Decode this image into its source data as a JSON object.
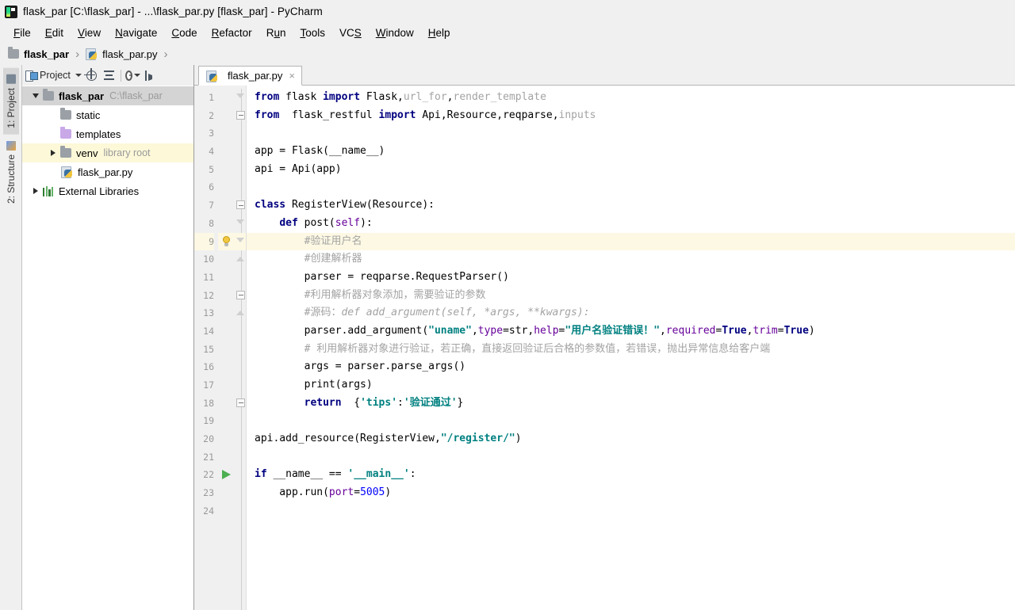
{
  "window": {
    "title": "flask_par [C:\\flask_par] - ...\\flask_par.py [flask_par] - PyCharm",
    "app_icon": "pycharm-icon"
  },
  "menubar": {
    "items": [
      {
        "label": "File",
        "mnemonic": "F"
      },
      {
        "label": "Edit",
        "mnemonic": "E"
      },
      {
        "label": "View",
        "mnemonic": "V"
      },
      {
        "label": "Navigate",
        "mnemonic": "N"
      },
      {
        "label": "Code",
        "mnemonic": "C"
      },
      {
        "label": "Refactor",
        "mnemonic": "R"
      },
      {
        "label": "Run",
        "mnemonic": "u"
      },
      {
        "label": "Tools",
        "mnemonic": "T"
      },
      {
        "label": "VCS",
        "mnemonic": "S"
      },
      {
        "label": "Window",
        "mnemonic": "W"
      },
      {
        "label": "Help",
        "mnemonic": "H"
      }
    ]
  },
  "breadcrumb": {
    "items": [
      {
        "label": "flask_par",
        "icon": "folder-icon",
        "bold": true
      },
      {
        "label": "flask_par.py",
        "icon": "python-file-icon",
        "bold": false
      }
    ],
    "separator": "›"
  },
  "left_toolwindows": [
    {
      "label": "1: Project",
      "icon": "project-window-icon",
      "active": true
    },
    {
      "label": "2: Structure",
      "icon": "structure-window-icon",
      "active": false
    }
  ],
  "project_panel": {
    "toolbar": {
      "title": "Project",
      "buttons": [
        {
          "name": "locate-file-icon",
          "tooltip": "Select Opened File"
        },
        {
          "name": "collapse-all-icon",
          "tooltip": "Collapse All"
        },
        {
          "name": "gear-icon",
          "tooltip": "Settings"
        },
        {
          "name": "hide-icon",
          "tooltip": "Hide"
        }
      ]
    },
    "tree": [
      {
        "label": "flask_par",
        "sub": "C:\\flask_par",
        "icon": "folder-icon",
        "indent": 0,
        "expander": "down",
        "selected": true,
        "bold": true
      },
      {
        "label": "static",
        "sub": "",
        "icon": "folder-icon",
        "indent": 1,
        "expander": "none",
        "selected": false,
        "bold": false
      },
      {
        "label": "templates",
        "sub": "",
        "icon": "folder-purple-icon",
        "indent": 1,
        "expander": "none",
        "selected": false,
        "bold": false
      },
      {
        "label": "venv",
        "sub": "library root",
        "icon": "folder-icon",
        "indent": 1,
        "expander": "right",
        "selected": false,
        "bold": false,
        "highlight": true
      },
      {
        "label": "flask_par.py",
        "sub": "",
        "icon": "python-file-icon",
        "indent": 1,
        "expander": "none",
        "selected": false,
        "bold": false
      },
      {
        "label": "External Libraries",
        "sub": "",
        "icon": "library-icon",
        "indent": 0,
        "expander": "right",
        "selected": false,
        "bold": false
      }
    ]
  },
  "editor": {
    "tabs": [
      {
        "label": "flask_par.py",
        "icon": "python-file-icon",
        "active": true,
        "close": "×"
      }
    ],
    "current_line": 9,
    "total_lines": 24,
    "gutter_marks": [
      {
        "line": 9,
        "icon": "lightbulb-icon"
      },
      {
        "line": 22,
        "icon": "run-arrow-icon"
      }
    ],
    "lines": [
      {
        "n": 1,
        "tokens": [
          {
            "t": "from",
            "c": "kw"
          },
          {
            "t": " flask ",
            "c": "plain"
          },
          {
            "t": "import",
            "c": "kw"
          },
          {
            "t": " Flask,",
            "c": "plain"
          },
          {
            "t": "url_for",
            "c": "dim"
          },
          {
            "t": ",",
            "c": "plain"
          },
          {
            "t": "render_template",
            "c": "dim"
          }
        ]
      },
      {
        "n": 2,
        "tokens": [
          {
            "t": "from",
            "c": "kw"
          },
          {
            "t": "  flask_restful ",
            "c": "plain"
          },
          {
            "t": "import",
            "c": "kw"
          },
          {
            "t": " Api,Resource,reqparse,",
            "c": "plain"
          },
          {
            "t": "inputs",
            "c": "dim"
          }
        ]
      },
      {
        "n": 3,
        "tokens": []
      },
      {
        "n": 4,
        "tokens": [
          {
            "t": "app = Flask(__name__)",
            "c": "plain"
          }
        ]
      },
      {
        "n": 5,
        "tokens": [
          {
            "t": "api = Api(app)",
            "c": "plain"
          }
        ]
      },
      {
        "n": 6,
        "tokens": []
      },
      {
        "n": 7,
        "tokens": [
          {
            "t": "class",
            "c": "kw"
          },
          {
            "t": " RegisterView(Resource):",
            "c": "plain"
          }
        ]
      },
      {
        "n": 8,
        "tokens": [
          {
            "t": "    ",
            "c": "plain"
          },
          {
            "t": "def",
            "c": "kw"
          },
          {
            "t": " post(",
            "c": "plain"
          },
          {
            "t": "self",
            "c": "kwarg"
          },
          {
            "t": "):",
            "c": "plain"
          }
        ]
      },
      {
        "n": 9,
        "tokens": [
          {
            "t": "        #验证用户名",
            "c": "cmt"
          }
        ]
      },
      {
        "n": 10,
        "tokens": [
          {
            "t": "        #创建解析器",
            "c": "cmt"
          }
        ]
      },
      {
        "n": 11,
        "tokens": [
          {
            "t": "        parser = reqparse.RequestParser()",
            "c": "plain"
          }
        ]
      },
      {
        "n": 12,
        "tokens": [
          {
            "t": "        #利用解析器对象添加，需要验证的参数",
            "c": "cmt"
          }
        ]
      },
      {
        "n": 13,
        "tokens": [
          {
            "t": "        #源码：",
            "c": "cmt"
          },
          {
            "t": "def add_argument(self, *args, **kwargs):",
            "c": "cmt-i"
          }
        ]
      },
      {
        "n": 14,
        "tokens": [
          {
            "t": "        parser.add_argument(",
            "c": "plain"
          },
          {
            "t": "\"uname\"",
            "c": "str"
          },
          {
            "t": ",",
            "c": "plain"
          },
          {
            "t": "type",
            "c": "kwarg"
          },
          {
            "t": "=str,",
            "c": "plain"
          },
          {
            "t": "help",
            "c": "kwarg"
          },
          {
            "t": "=",
            "c": "plain"
          },
          {
            "t": "\"用户名验证错误！\"",
            "c": "str"
          },
          {
            "t": ",",
            "c": "plain"
          },
          {
            "t": "required",
            "c": "kwarg"
          },
          {
            "t": "=",
            "c": "plain"
          },
          {
            "t": "True",
            "c": "kw"
          },
          {
            "t": ",",
            "c": "plain"
          },
          {
            "t": "trim",
            "c": "kwarg"
          },
          {
            "t": "=",
            "c": "plain"
          },
          {
            "t": "True",
            "c": "kw"
          },
          {
            "t": ")",
            "c": "plain"
          }
        ]
      },
      {
        "n": 15,
        "tokens": [
          {
            "t": "        # 利用解析器对象进行验证，若正确，直接返回验证后合格的参数值，若错误，抛出异常信息给客户端",
            "c": "cmt"
          }
        ]
      },
      {
        "n": 16,
        "tokens": [
          {
            "t": "        args = parser.parse_args()",
            "c": "plain"
          }
        ]
      },
      {
        "n": 17,
        "tokens": [
          {
            "t": "        print(args)",
            "c": "plain"
          }
        ]
      },
      {
        "n": 18,
        "tokens": [
          {
            "t": "        ",
            "c": "plain"
          },
          {
            "t": "return",
            "c": "kw"
          },
          {
            "t": "  {",
            "c": "plain"
          },
          {
            "t": "'tips'",
            "c": "str"
          },
          {
            "t": ":",
            "c": "plain"
          },
          {
            "t": "'验证通过'",
            "c": "str"
          },
          {
            "t": "}",
            "c": "plain"
          }
        ]
      },
      {
        "n": 19,
        "tokens": []
      },
      {
        "n": 20,
        "tokens": [
          {
            "t": "api.add_resource(RegisterView,",
            "c": "plain"
          },
          {
            "t": "\"/register/\"",
            "c": "str"
          },
          {
            "t": ")",
            "c": "plain"
          }
        ]
      },
      {
        "n": 21,
        "tokens": []
      },
      {
        "n": 22,
        "tokens": [
          {
            "t": "if",
            "c": "kw"
          },
          {
            "t": " __name__ == ",
            "c": "plain"
          },
          {
            "t": "'__main__'",
            "c": "str"
          },
          {
            "t": ":",
            "c": "plain"
          }
        ]
      },
      {
        "n": 23,
        "tokens": [
          {
            "t": "    app.run(",
            "c": "plain"
          },
          {
            "t": "port",
            "c": "kwarg"
          },
          {
            "t": "=",
            "c": "plain"
          },
          {
            "t": "5005",
            "c": "num"
          },
          {
            "t": ")",
            "c": "plain"
          }
        ]
      },
      {
        "n": 24,
        "tokens": []
      }
    ]
  },
  "colors": {
    "keyword": "#000080",
    "string": "#008080",
    "comment": "#a3a3a3",
    "number": "#0000ff",
    "kwarg": "#660099",
    "current_line_bg": "#fcf8e3",
    "tree_selected_bg": "#d4d4d4",
    "tree_highlight_bg": "#fcf8d8",
    "chrome_bg": "#f0f0f0",
    "editor_bg": "#ffffff"
  }
}
